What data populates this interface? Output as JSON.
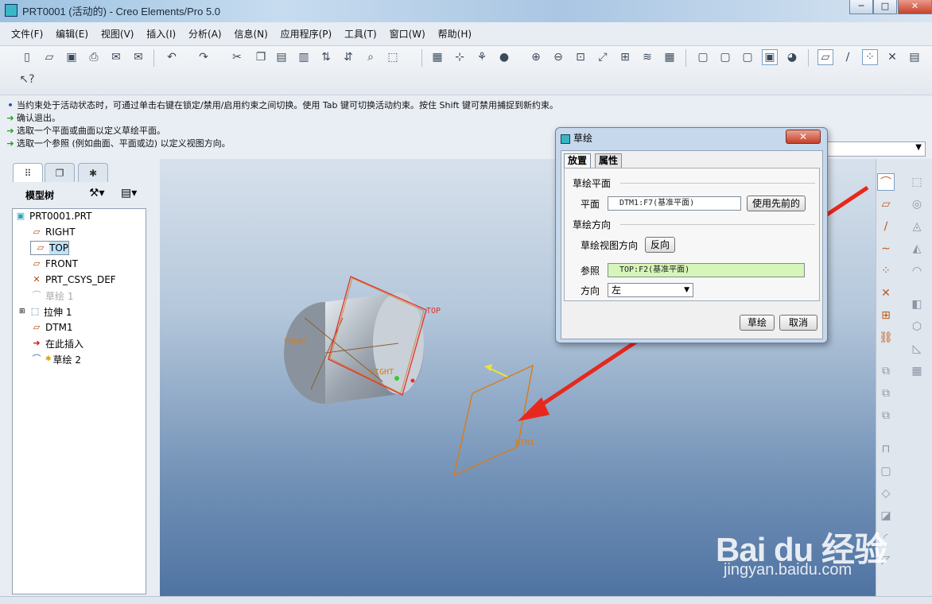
{
  "window": {
    "title": "PRT0001 (活动的) - Creo Elements/Pro 5.0",
    "min_label": "─",
    "max_label": "□",
    "close_label": "✕"
  },
  "menu": [
    "文件(F)",
    "编辑(E)",
    "视图(V)",
    "插入(I)",
    "分析(A)",
    "信息(N)",
    "应用程序(P)",
    "工具(T)",
    "窗口(W)",
    "帮助(H)"
  ],
  "messages": [
    {
      "icon": "info",
      "text": "当约束处于活动状态时，可通过单击右键在锁定/禁用/启用约束之间切换。使用 Tab 键可切换活动约束。按住 Shift 键可禁用捕捉到新约束。"
    },
    {
      "icon": "arrow",
      "text": "确认退出。"
    },
    {
      "icon": "arrow",
      "text": "选取一个平面或曲面以定义草绘平面。"
    },
    {
      "icon": "arrow",
      "text": "选取一个参照 (例如曲面、平面或边) 以定义视图方向。"
    }
  ],
  "model_tree": {
    "title": "模型树",
    "items": [
      {
        "label": "PRT0001.PRT",
        "icon": "part-icon",
        "indent": 0
      },
      {
        "label": "RIGHT",
        "icon": "datum-plane-icon",
        "indent": 1
      },
      {
        "label": "TOP",
        "icon": "datum-plane-icon",
        "indent": 1,
        "selected": true
      },
      {
        "label": "FRONT",
        "icon": "datum-plane-icon",
        "indent": 1
      },
      {
        "label": "PRT_CSYS_DEF",
        "icon": "csys-icon",
        "indent": 1
      },
      {
        "label": "草绘 1",
        "icon": "sketch-icon",
        "indent": 1,
        "dimmed": true
      },
      {
        "label": "拉伸 1",
        "icon": "extrude-icon",
        "indent": 1,
        "expandable": true
      },
      {
        "label": "DTM1",
        "icon": "datum-plane-icon",
        "indent": 1
      },
      {
        "label": "在此插入",
        "icon": "insert-here-icon",
        "indent": 1
      },
      {
        "label": "草绘 2",
        "icon": "sketch-icon",
        "indent": 1,
        "new": true
      }
    ]
  },
  "viewport_labels": {
    "front": "FRONT",
    "top": "TOP",
    "right": "RIGHT",
    "dtm1": "DTM1"
  },
  "dialog": {
    "title": "草绘",
    "close_label": "✕",
    "tabs": [
      "放置",
      "属性"
    ],
    "section_plane": "草绘平面",
    "plane_label": "平面",
    "plane_value": "DTM1:F7(基准平面)",
    "use_previous": "使用先前的",
    "section_orient": "草绘方向",
    "view_dir_label": "草绘视图方向",
    "flip": "反向",
    "ref_label": "参照",
    "ref_value": "TOP:F2(基准平面)",
    "dir_label": "方向",
    "dir_value": "左",
    "ok": "草绘",
    "cancel": "取消"
  },
  "watermark": {
    "main": "Bai du 经验",
    "url": "jingyan.baidu.com"
  },
  "colors": {
    "datum_orange": "#d97b1a",
    "highlight_red": "#e03030",
    "arrow_red": "#e8281c",
    "ref_field_green": "#d6f5b8"
  }
}
